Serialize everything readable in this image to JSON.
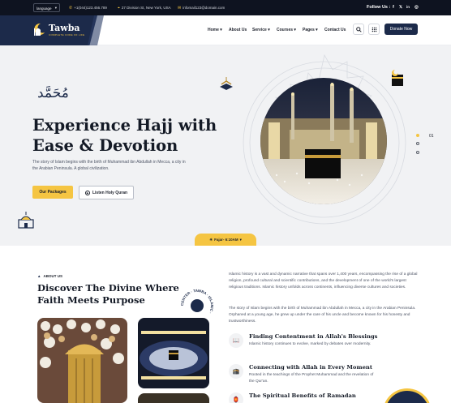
{
  "topbar": {
    "language": "language",
    "phone": "+1(044)123.456.789",
    "address": "27 Division St, New York, USA",
    "email": "infomail123@domain.com",
    "follow_label": "Follow Us :",
    "social": [
      "f",
      "𝕏",
      "in",
      "◎"
    ]
  },
  "brand": {
    "name": "Tawba",
    "tagline": "COMPLETE CODE OF LIFE"
  },
  "nav": {
    "items": [
      "Home",
      "About Us",
      "Service",
      "Courses",
      "Pages",
      "Contact Us"
    ],
    "dropdown_marker": "▾",
    "donate": "Donate Now"
  },
  "hero": {
    "calligraphy": "مُحَمَّد",
    "title": "Experience Hajj with Ease & Devotion",
    "subtitle": "The story of Islam begins with the birth of Muhammad ibn Abdullah in Mecca, a city in the Arabian Peninsula. A global civilization.",
    "primary_button": "Our Packages",
    "secondary_button": "Listen Holy Quran",
    "slide_number": "01",
    "prayer": "Fajar- 6:10AM"
  },
  "about": {
    "tag": "ABOUT US",
    "title": "Discover The Divine Where Faith Meets Purpose",
    "badge_text": "CENTER · TAWBA · ISLAMIC · ",
    "para1": "Islamic history is a vast and dynamic narrative that spans over 1,400 years, encompassing the rise of a global religion, profound cultural and scientific contributions, and the development of one of the world's largest religious traditions. Islamic history unfolds across continents, influencing diverse cultures and societies.",
    "para2": "The story of Islam begins with the birth of Muhammad ibn Abdullah in Mecca, a city in the Arabian Peninsula. Orphaned at a young age, he grew up under the care of his uncle and become known for his honesty and trustworthiness.",
    "features": [
      {
        "title": "Finding Contentment in Allah's Blessings",
        "desc": "Islamic history continues to evolve, marked by debates over modernity."
      },
      {
        "title": "Connecting with Allah in Every Moment",
        "desc": "Rooted in the teachings of the Prophet Muhammad and the revelation of the Qur'an."
      },
      {
        "title": "The Spiritual Benefits of Ramadan",
        "desc": ""
      }
    ]
  },
  "colors": {
    "accent": "#f5c542",
    "navy": "#1c2a4a",
    "dark": "#0e1320"
  }
}
